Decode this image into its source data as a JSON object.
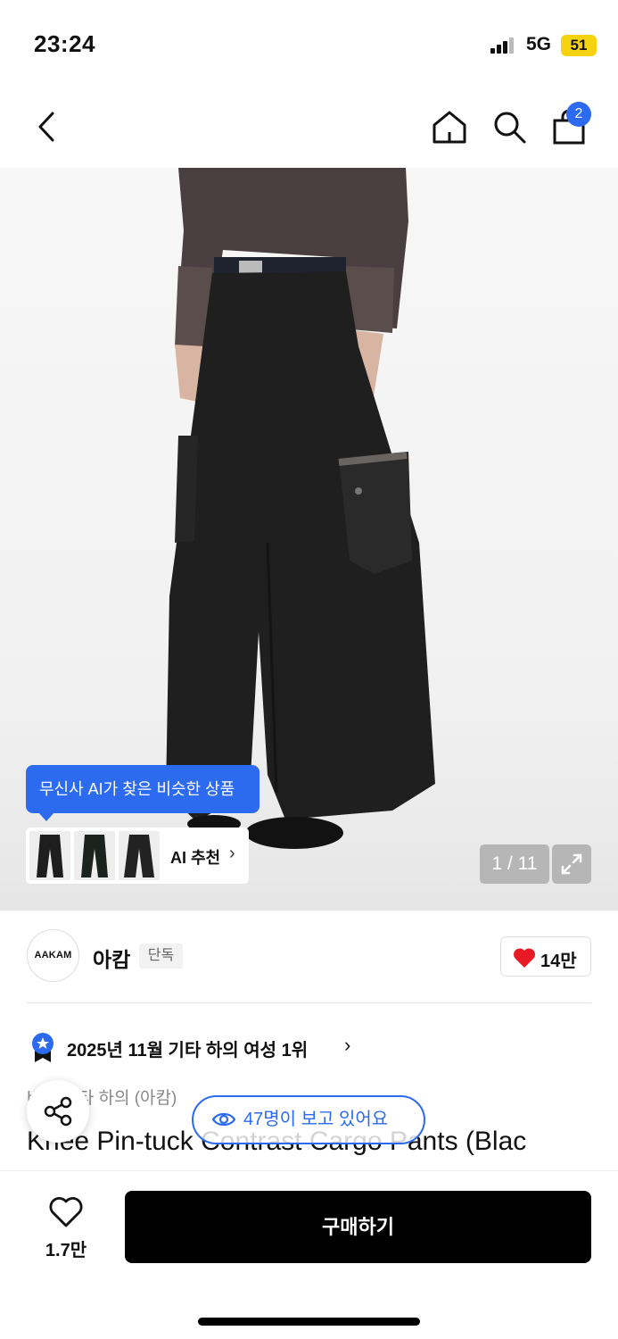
{
  "status_bar": {
    "time": "23:24",
    "network": "5G",
    "battery": "51"
  },
  "nav": {
    "cart_count": "2",
    "icons": [
      "back-icon",
      "home-icon",
      "search-icon",
      "shopping-bag-icon"
    ]
  },
  "gallery": {
    "ai_tooltip": "무신사 AI가 찾은 비슷한 상품",
    "ai_recommend_label": "AI 추천",
    "counter": "1 / 11"
  },
  "brand": {
    "logo_text": "AAKAM",
    "name": "아캄",
    "tag": "단독",
    "likes": "14만"
  },
  "ranking": {
    "text": "2025년 11월 기타 하의 여성 1위"
  },
  "product": {
    "category": "바지  기타 하의 (아캄)",
    "name": "Knee Pin-tuck Contrast Cargo Pants (Blac"
  },
  "viewers": "47명이 보고 있어요",
  "bottom_bar": {
    "wish_count": "1.7만",
    "buy_label": "구매하기"
  },
  "colors": {
    "accent": "#2C6BF0",
    "heart": "#E81B24",
    "battery": "#F5D30F"
  }
}
